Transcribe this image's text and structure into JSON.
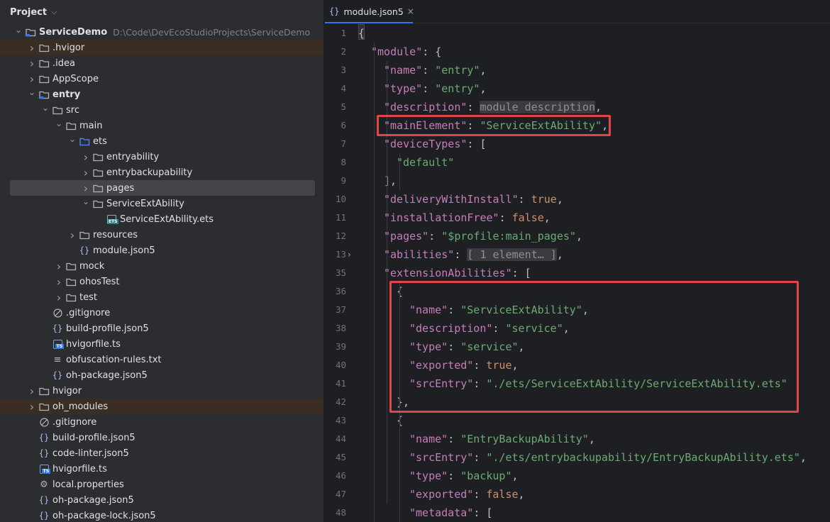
{
  "panel": {
    "title": "Project"
  },
  "colors": {
    "highlight_box": "#e0464c",
    "key": "#c77dbb",
    "string": "#6aab73",
    "keyword": "#cf8e6d",
    "accent": "#3574f0"
  },
  "tree": [
    {
      "label": "ServiceDemo",
      "path": "D:\\Code\\DevEcoStudioProjects\\ServiceDemo",
      "icon": "module-folder-icon",
      "arrow": "open",
      "bold": true,
      "depth": 0
    },
    {
      "label": ".hvigor",
      "icon": "folder-icon",
      "arrow": "closed",
      "depth": 1,
      "hl": true
    },
    {
      "label": ".idea",
      "icon": "folder-icon",
      "arrow": "closed",
      "depth": 1
    },
    {
      "label": "AppScope",
      "icon": "folder-icon",
      "arrow": "closed",
      "depth": 1
    },
    {
      "label": "entry",
      "icon": "module-folder-icon",
      "arrow": "open",
      "bold": true,
      "depth": 1
    },
    {
      "label": "src",
      "icon": "folder-icon",
      "arrow": "open",
      "depth": 2
    },
    {
      "label": "main",
      "icon": "folder-icon",
      "arrow": "open",
      "depth": 3
    },
    {
      "label": "ets",
      "icon": "source-folder-icon",
      "arrow": "open",
      "depth": 4
    },
    {
      "label": "entryability",
      "icon": "folder-icon",
      "arrow": "closed",
      "depth": 5
    },
    {
      "label": "entrybackupability",
      "icon": "folder-icon",
      "arrow": "closed",
      "depth": 5
    },
    {
      "label": "pages",
      "icon": "folder-icon",
      "arrow": "closed",
      "depth": 5,
      "sel": true
    },
    {
      "label": "ServiceExtAbility",
      "icon": "folder-icon",
      "arrow": "open",
      "depth": 5
    },
    {
      "label": "ServiceExtAbility.ets",
      "icon": "ets-file-icon",
      "arrow": "none",
      "depth": 6
    },
    {
      "label": "resources",
      "icon": "folder-icon",
      "arrow": "closed",
      "depth": 4
    },
    {
      "label": "module.json5",
      "icon": "json-file-icon",
      "arrow": "none",
      "depth": 4
    },
    {
      "label": "mock",
      "icon": "folder-icon",
      "arrow": "closed",
      "depth": 3
    },
    {
      "label": "ohosTest",
      "icon": "folder-icon",
      "arrow": "closed",
      "depth": 3
    },
    {
      "label": "test",
      "icon": "folder-icon",
      "arrow": "closed",
      "depth": 3
    },
    {
      "label": ".gitignore",
      "icon": "gitignore-icon",
      "arrow": "none",
      "depth": 2
    },
    {
      "label": "build-profile.json5",
      "icon": "json-file-icon",
      "arrow": "none",
      "depth": 2
    },
    {
      "label": "hvigorfile.ts",
      "icon": "ts-file-icon",
      "arrow": "none",
      "depth": 2
    },
    {
      "label": "obfuscation-rules.txt",
      "icon": "text-file-icon",
      "arrow": "none",
      "depth": 2
    },
    {
      "label": "oh-package.json5",
      "icon": "json-file-icon",
      "arrow": "none",
      "depth": 2
    },
    {
      "label": "hvigor",
      "icon": "folder-icon",
      "arrow": "closed",
      "depth": 1
    },
    {
      "label": "oh_modules",
      "icon": "folder-icon",
      "arrow": "closed",
      "depth": 1,
      "hl": true
    },
    {
      "label": ".gitignore",
      "icon": "gitignore-icon",
      "arrow": "none",
      "depth": 1
    },
    {
      "label": "build-profile.json5",
      "icon": "json-file-icon",
      "arrow": "none",
      "depth": 1
    },
    {
      "label": "code-linter.json5",
      "icon": "json-file-icon",
      "arrow": "none",
      "depth": 1
    },
    {
      "label": "hvigorfile.ts",
      "icon": "ts-file-icon",
      "arrow": "none",
      "depth": 1
    },
    {
      "label": "local.properties",
      "icon": "settings-file-icon",
      "arrow": "none",
      "depth": 1
    },
    {
      "label": "oh-package.json5",
      "icon": "json-file-icon",
      "arrow": "none",
      "depth": 1
    },
    {
      "label": "oh-package-lock.json5",
      "icon": "json-file-icon",
      "arrow": "none",
      "depth": 1
    }
  ],
  "editor": {
    "tab": {
      "label": "module.json5",
      "close": "×"
    },
    "lines": [
      {
        "n": "1",
        "ind": 0,
        "t": [
          [
            "p",
            "{"
          ]
        ]
      },
      {
        "n": "2",
        "ind": 1,
        "t": [
          [
            "k",
            "\"module\""
          ],
          [
            "p",
            ": {"
          ]
        ]
      },
      {
        "n": "3",
        "ind": 2,
        "t": [
          [
            "k",
            "\"name\""
          ],
          [
            "p",
            ": "
          ],
          [
            "s",
            "\"entry\""
          ],
          [
            "p",
            ","
          ]
        ]
      },
      {
        "n": "4",
        "ind": 2,
        "t": [
          [
            "k",
            "\"type\""
          ],
          [
            "p",
            ": "
          ],
          [
            "s",
            "\"entry\""
          ],
          [
            "p",
            ","
          ]
        ]
      },
      {
        "n": "5",
        "ind": 2,
        "t": [
          [
            "k",
            "\"description\""
          ],
          [
            "p",
            ": "
          ],
          [
            "fo",
            "module description"
          ],
          [
            "p",
            ","
          ]
        ]
      },
      {
        "n": "6",
        "ind": 2,
        "t": [
          [
            "k",
            "\"mainElement\""
          ],
          [
            "p",
            ": "
          ],
          [
            "s",
            "\"ServiceExtAbility\""
          ],
          [
            "p",
            ","
          ]
        ]
      },
      {
        "n": "7",
        "ind": 2,
        "t": [
          [
            "k",
            "\"deviceTypes\""
          ],
          [
            "p",
            ": ["
          ]
        ]
      },
      {
        "n": "8",
        "ind": 3,
        "t": [
          [
            "s",
            "\"default\""
          ]
        ]
      },
      {
        "n": "9",
        "ind": 2,
        "t": [
          [
            "p",
            "],"
          ]
        ]
      },
      {
        "n": "10",
        "ind": 2,
        "t": [
          [
            "k",
            "\"deliveryWithInstall\""
          ],
          [
            "p",
            ": "
          ],
          [
            "b",
            "true"
          ],
          [
            "p",
            ","
          ]
        ]
      },
      {
        "n": "11",
        "ind": 2,
        "t": [
          [
            "k",
            "\"installationFree\""
          ],
          [
            "p",
            ": "
          ],
          [
            "b",
            "false"
          ],
          [
            "p",
            ","
          ]
        ]
      },
      {
        "n": "12",
        "ind": 2,
        "t": [
          [
            "k",
            "\"pages\""
          ],
          [
            "p",
            ": "
          ],
          [
            "s",
            "\"$profile:main_pages\""
          ],
          [
            "p",
            ","
          ]
        ]
      },
      {
        "n": "13",
        "ind": 2,
        "fold": true,
        "t": [
          [
            "k",
            "\"abilities\""
          ],
          [
            "p",
            ": "
          ],
          [
            "fo",
            "[ 1 element… ]"
          ],
          [
            "p",
            ","
          ]
        ]
      },
      {
        "n": "35",
        "ind": 2,
        "t": [
          [
            "k",
            "\"extensionAbilities\""
          ],
          [
            "p",
            ": ["
          ]
        ]
      },
      {
        "n": "36",
        "ind": 3,
        "t": [
          [
            "p",
            "{"
          ]
        ]
      },
      {
        "n": "37",
        "ind": 4,
        "t": [
          [
            "k",
            "\"name\""
          ],
          [
            "p",
            ": "
          ],
          [
            "s",
            "\"ServiceExtAbility\""
          ],
          [
            "p",
            ","
          ]
        ]
      },
      {
        "n": "38",
        "ind": 4,
        "t": [
          [
            "k",
            "\"description\""
          ],
          [
            "p",
            ": "
          ],
          [
            "s",
            "\"service\""
          ],
          [
            "p",
            ","
          ]
        ]
      },
      {
        "n": "39",
        "ind": 4,
        "t": [
          [
            "k",
            "\"type\""
          ],
          [
            "p",
            ": "
          ],
          [
            "s",
            "\"service\""
          ],
          [
            "p",
            ","
          ]
        ]
      },
      {
        "n": "40",
        "ind": 4,
        "t": [
          [
            "k",
            "\"exported\""
          ],
          [
            "p",
            ": "
          ],
          [
            "b",
            "true"
          ],
          [
            "p",
            ","
          ]
        ]
      },
      {
        "n": "41",
        "ind": 4,
        "t": [
          [
            "k",
            "\"srcEntry\""
          ],
          [
            "p",
            ": "
          ],
          [
            "s",
            "\"./ets/ServiceExtAbility/ServiceExtAbility.ets\""
          ]
        ]
      },
      {
        "n": "42",
        "ind": 3,
        "t": [
          [
            "p",
            "},"
          ]
        ]
      },
      {
        "n": "43",
        "ind": 3,
        "t": [
          [
            "p",
            "{"
          ]
        ]
      },
      {
        "n": "44",
        "ind": 4,
        "t": [
          [
            "k",
            "\"name\""
          ],
          [
            "p",
            ": "
          ],
          [
            "s",
            "\"EntryBackupAbility\""
          ],
          [
            "p",
            ","
          ]
        ]
      },
      {
        "n": "45",
        "ind": 4,
        "t": [
          [
            "k",
            "\"srcEntry\""
          ],
          [
            "p",
            ": "
          ],
          [
            "s",
            "\"./ets/entrybackupability/EntryBackupAbility.ets\""
          ],
          [
            "p",
            ","
          ]
        ]
      },
      {
        "n": "46",
        "ind": 4,
        "t": [
          [
            "k",
            "\"type\""
          ],
          [
            "p",
            ": "
          ],
          [
            "s",
            "\"backup\""
          ],
          [
            "p",
            ","
          ]
        ]
      },
      {
        "n": "47",
        "ind": 4,
        "t": [
          [
            "k",
            "\"exported\""
          ],
          [
            "p",
            ": "
          ],
          [
            "b",
            "false"
          ],
          [
            "p",
            ","
          ]
        ]
      },
      {
        "n": "48",
        "ind": 4,
        "t": [
          [
            "k",
            "\"metadata\""
          ],
          [
            "p",
            ": ["
          ]
        ]
      }
    ]
  }
}
